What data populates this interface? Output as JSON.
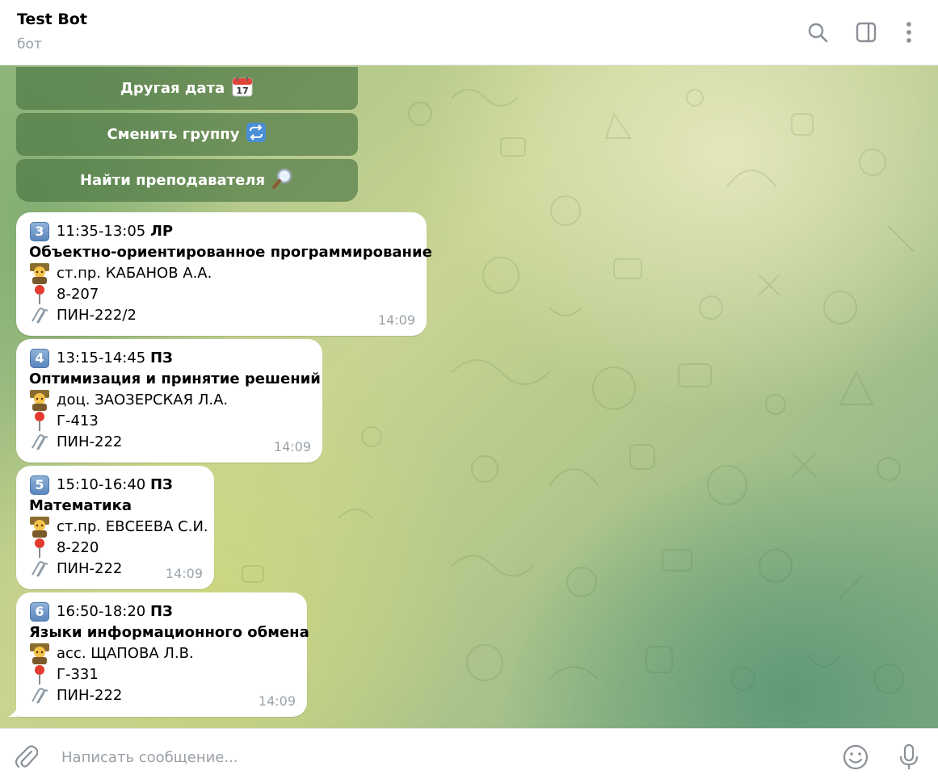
{
  "header": {
    "title": "Test Bot",
    "subtitle": "бот"
  },
  "keyboard": [
    {
      "label": "Другая дата",
      "icon": "calendar-icon"
    },
    {
      "label": "Сменить группу",
      "icon": "repeat-icon"
    },
    {
      "label": "Найти преподавателя",
      "icon": "magnifier-icon"
    }
  ],
  "messages": [
    {
      "number": "3",
      "time_range": "11:35-13:05",
      "type": "ЛР",
      "subject": "Объектно-ориентированное программирование",
      "teacher": "ст.пр. КАБАНОВ А.А.",
      "room": "8-207",
      "group": "ПИН-222/2",
      "sent": "14:09"
    },
    {
      "number": "4",
      "time_range": "13:15-14:45",
      "type": "ПЗ",
      "subject": "Оптимизация и принятие решений",
      "teacher": "доц. ЗАОЗЕРСКАЯ Л.А.",
      "room": "Г-413",
      "group": "ПИН-222",
      "sent": "14:09"
    },
    {
      "number": "5",
      "time_range": "15:10-16:40",
      "type": "ПЗ",
      "subject": "Математика",
      "teacher": "ст.пр. ЕВСЕЕВА С.И.",
      "room": "8-220",
      "group": "ПИН-222",
      "sent": "14:09"
    },
    {
      "number": "6",
      "time_range": "16:50-18:20",
      "type": "ПЗ",
      "subject": "Языки информационного обмена",
      "teacher": "асс. ЩАПОВА Л.В.",
      "room": "Г-331",
      "group": "ПИН-222",
      "sent": "14:09"
    }
  ],
  "composer": {
    "placeholder": "Написать сообщение..."
  },
  "colors": {
    "keyboard_button": "#46703e",
    "bubble": "#ffffff",
    "timestamp": "#9aa3aa"
  }
}
